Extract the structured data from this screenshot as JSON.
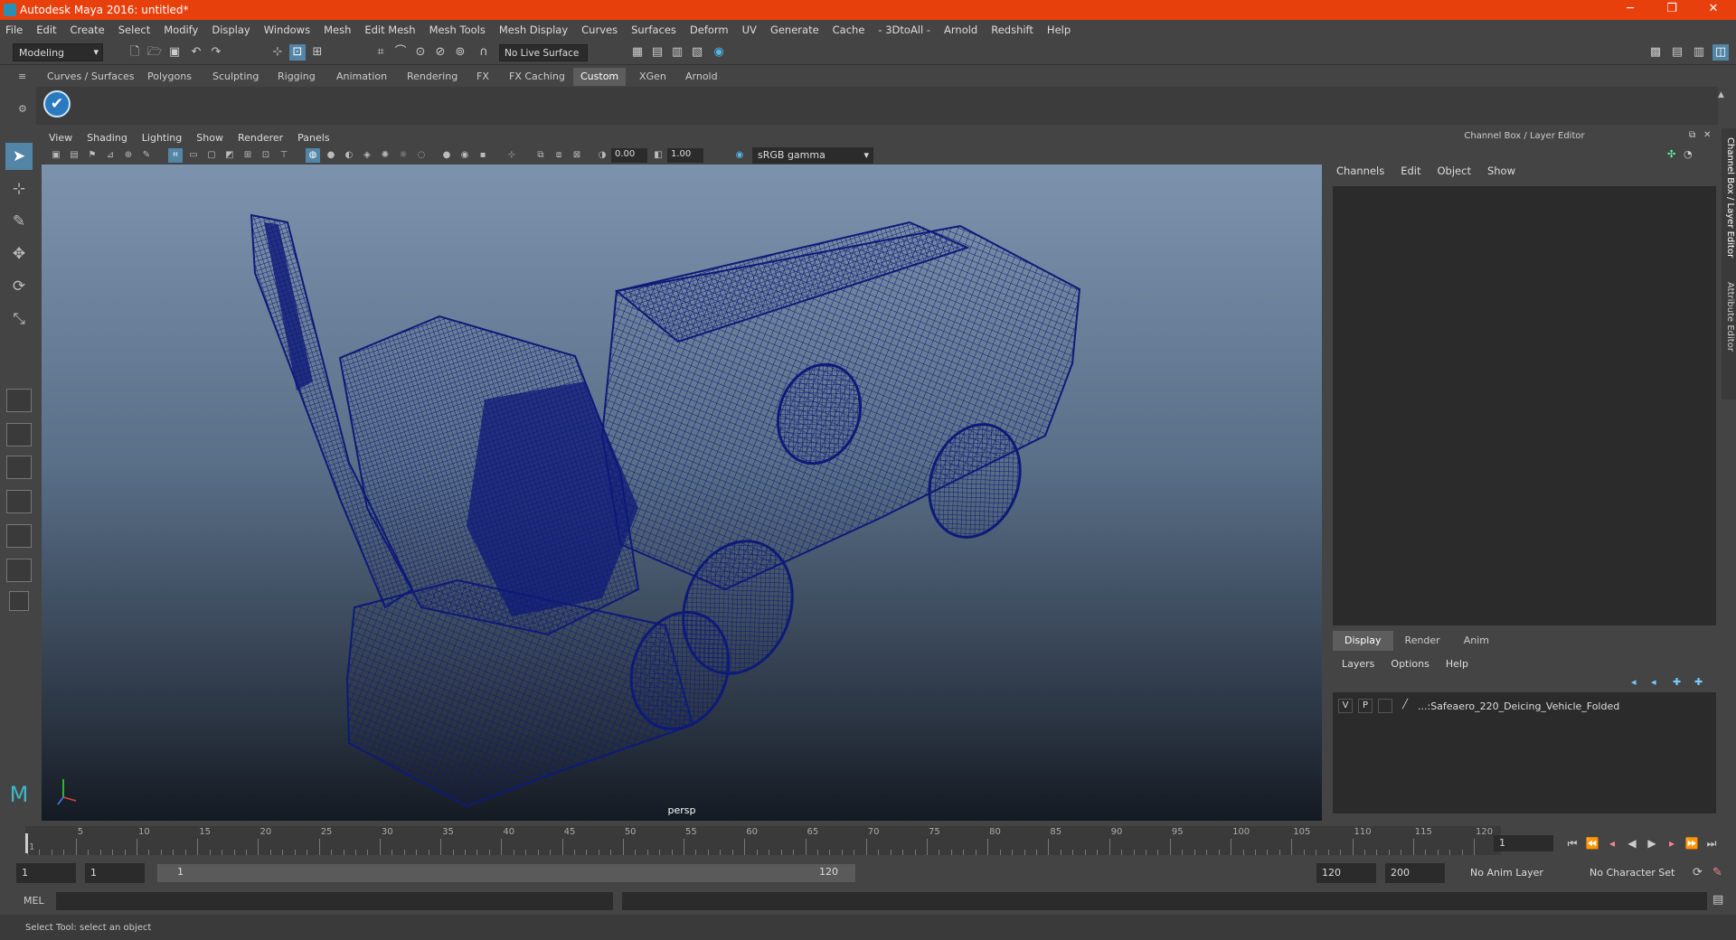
{
  "app": {
    "title": "Autodesk Maya 2016: untitled*",
    "minimize": "─",
    "restore": "❐",
    "close": "✕"
  },
  "menus": [
    "File",
    "Edit",
    "Create",
    "Select",
    "Modify",
    "Display",
    "Windows",
    "Mesh",
    "Edit Mesh",
    "Mesh Tools",
    "Mesh Display",
    "Curves",
    "Surfaces",
    "Deform",
    "UV",
    "Generate",
    "Cache",
    "- 3DtoAll -",
    "Arnold",
    "Redshift",
    "Help"
  ],
  "status": {
    "mode": "Modeling",
    "live_surface": "No Live Surface"
  },
  "shelf_tabs": [
    "Curves / Surfaces",
    "Polygons",
    "Sculpting",
    "Rigging",
    "Animation",
    "Rendering",
    "FX",
    "FX Caching",
    "Custom",
    "XGen",
    "Arnold"
  ],
  "shelf_active": "Custom",
  "viewport": {
    "menus": [
      "View",
      "Shading",
      "Lighting",
      "Show",
      "Renderer",
      "Panels"
    ],
    "exposure": "0.00",
    "gamma": "1.00",
    "color_space": "sRGB gamma",
    "camera": "persp"
  },
  "channel_box": {
    "title": "Channel Box / Layer Editor",
    "menus": [
      "Channels",
      "Edit",
      "Object",
      "Show"
    ]
  },
  "layer_editor": {
    "tabs": [
      "Display",
      "Render",
      "Anim"
    ],
    "active_tab": "Display",
    "menus": [
      "Layers",
      "Options",
      "Help"
    ],
    "layer": {
      "v": "V",
      "p": "P",
      "name": "...:Safeaero_220_Deicing_Vehicle_Folded"
    }
  },
  "side_tabs": [
    "Channel Box / Layer Editor",
    "Attribute Editor"
  ],
  "timeline": {
    "ticks": [
      "1",
      "5",
      "10",
      "15",
      "20",
      "25",
      "30",
      "35",
      "40",
      "45",
      "50",
      "55",
      "60",
      "65",
      "70",
      "75",
      "80",
      "85",
      "90",
      "95",
      "100",
      "105",
      "110",
      "115",
      "120"
    ],
    "current_frame": "1"
  },
  "range": {
    "start": "1",
    "inner_start": "1",
    "range_start_label": "1",
    "range_end_label": "120",
    "end": "120",
    "max": "200",
    "anim_layer": "No Anim Layer",
    "character_set": "No Character Set"
  },
  "mel": {
    "label": "MEL"
  },
  "help": {
    "text": "Select Tool: select an object"
  },
  "colors": {
    "title_bar": "#e8400c",
    "wireframe": "#0e1a78",
    "panel": "#444444"
  }
}
